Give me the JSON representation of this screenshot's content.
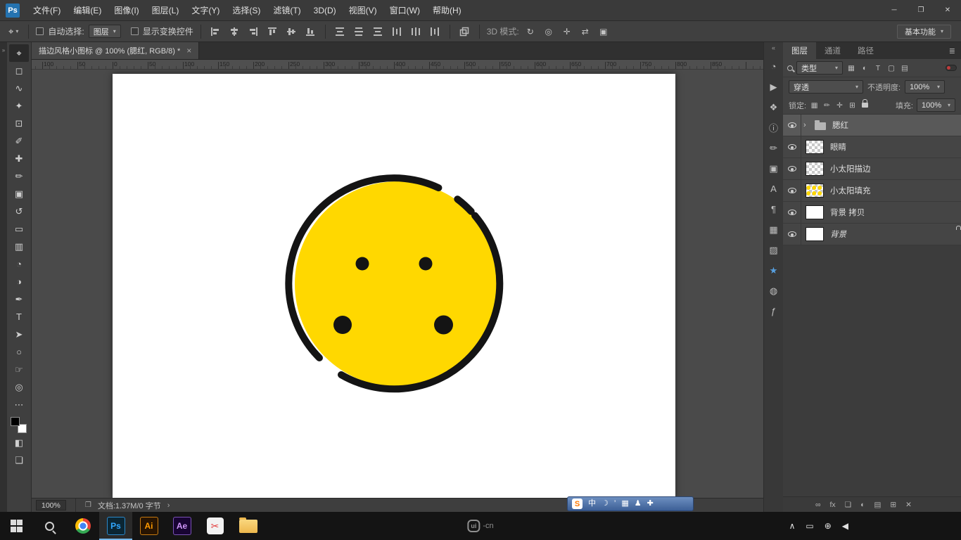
{
  "colors": {
    "canvas_yellow": "#ffd800",
    "ink": "#141414",
    "ps_blue": "#31a8ff",
    "star_blue": "#57a0e0",
    "sogou_orange": "#ff7a00",
    "taskbar_active": "#76b9ed"
  },
  "titlebar": {
    "app_badge": "Ps",
    "menus": [
      {
        "name": "menu-file",
        "label": "文件(F)"
      },
      {
        "name": "menu-edit",
        "label": "编辑(E)"
      },
      {
        "name": "menu-image",
        "label": "图像(I)"
      },
      {
        "name": "menu-layer",
        "label": "图层(L)"
      },
      {
        "name": "menu-type",
        "label": "文字(Y)"
      },
      {
        "name": "menu-select",
        "label": "选择(S)"
      },
      {
        "name": "menu-filter",
        "label": "滤镜(T)"
      },
      {
        "name": "menu-3d",
        "label": "3D(D)"
      },
      {
        "name": "menu-view",
        "label": "视图(V)"
      },
      {
        "name": "menu-window",
        "label": "窗口(W)"
      },
      {
        "name": "menu-help",
        "label": "帮助(H)"
      }
    ],
    "controls": [
      {
        "name": "minimize-button",
        "glyph": "─"
      },
      {
        "name": "restore-button",
        "glyph": "❐"
      },
      {
        "name": "close-button",
        "glyph": "✕"
      }
    ]
  },
  "options_bar": {
    "tool_glyph": "⌖",
    "auto_select_label": "自动选择:",
    "target_value": "图层",
    "show_transform_label": "显示变换控件",
    "mode_label": "3D 模式:",
    "mode_icons": [
      {
        "name": "3d-rotate-icon",
        "glyph": "↻"
      },
      {
        "name": "3d-roll-icon",
        "glyph": "◎"
      },
      {
        "name": "3d-pan-icon",
        "glyph": "✛"
      },
      {
        "name": "3d-slide-icon",
        "glyph": "⇄"
      },
      {
        "name": "3d-scale-icon",
        "glyph": "▣"
      }
    ],
    "workspace_button": "基本功能"
  },
  "document_tab": {
    "title": "描边风格小图标 @ 100% (腮红, RGB/8) *",
    "close_glyph": "×"
  },
  "toolbar": {
    "collapse_glyph": "»",
    "tools": [
      {
        "name": "move-tool",
        "glyph": "⌖",
        "active": true
      },
      {
        "name": "marquee-tool",
        "glyph": "◻"
      },
      {
        "name": "lasso-tool",
        "glyph": "∿"
      },
      {
        "name": "quick-selection-tool",
        "glyph": "✦"
      },
      {
        "name": "crop-tool",
        "glyph": "⊡"
      },
      {
        "name": "eyedropper-tool",
        "glyph": "✐"
      },
      {
        "name": "healing-brush-tool",
        "glyph": "✚"
      },
      {
        "name": "brush-tool",
        "glyph": "✏"
      },
      {
        "name": "clone-stamp-tool",
        "glyph": "▣"
      },
      {
        "name": "history-brush-tool",
        "glyph": "↺"
      },
      {
        "name": "eraser-tool",
        "glyph": "▭"
      },
      {
        "name": "gradient-tool",
        "glyph": "▥"
      },
      {
        "name": "blur-tool",
        "glyph": "◔"
      },
      {
        "name": "dodge-tool",
        "glyph": "◑"
      },
      {
        "name": "pen-tool",
        "glyph": "✒"
      },
      {
        "name": "type-tool",
        "glyph": "T"
      },
      {
        "name": "path-selection-tool",
        "glyph": "➤"
      },
      {
        "name": "shape-tool",
        "glyph": "○"
      },
      {
        "name": "hand-tool",
        "glyph": "☞"
      },
      {
        "name": "zoom-tool",
        "glyph": "◎"
      },
      {
        "name": "edit-toolbar-button",
        "glyph": "⋯"
      }
    ],
    "bottom_tools": [
      {
        "name": "quick-mask-button",
        "glyph": "◧"
      },
      {
        "name": "screen-mode-button",
        "glyph": "❏"
      }
    ]
  },
  "ruler": {
    "labels": [
      "100",
      "50",
      "0",
      "50",
      "100",
      "150",
      "200",
      "250",
      "300",
      "350",
      "400",
      "450",
      "500",
      "550",
      "600",
      "650",
      "700",
      "750",
      "800",
      "850"
    ]
  },
  "status_bar": {
    "zoom": "100%",
    "doc_icon": "❐",
    "doc_info": "文档:1.37M/0 字节",
    "expand_glyph": "›"
  },
  "panel_strip": {
    "collapse_glyph": "«",
    "icons": [
      {
        "name": "history-panel-icon",
        "glyph": "◔"
      },
      {
        "name": "actions-panel-icon",
        "glyph": "▶"
      },
      {
        "name": "adjustments-panel-icon",
        "glyph": "❖"
      },
      {
        "name": "info-panel-icon",
        "glyph": "ⓘ"
      },
      {
        "name": "brush-settings-panel-icon",
        "glyph": "✏"
      },
      {
        "name": "clone-source-panel-icon",
        "glyph": "▣"
      },
      {
        "name": "character-panel-icon",
        "glyph": "A"
      },
      {
        "name": "paragraph-panel-icon",
        "glyph": "¶"
      },
      {
        "name": "swatches-panel-icon",
        "glyph": "▦"
      },
      {
        "name": "styles-panel-icon",
        "glyph": "▨"
      },
      {
        "name": "favorites-panel-icon",
        "glyph": "★",
        "color": "#57a0e0"
      },
      {
        "name": "libraries-panel-icon",
        "glyph": "◍"
      },
      {
        "name": "layer-comps-panel-icon",
        "glyph": "ƒ"
      }
    ]
  },
  "layers_panel": {
    "tabs": [
      {
        "name": "tab-layers",
        "label": "图层",
        "active": true
      },
      {
        "name": "tab-channels",
        "label": "通道"
      },
      {
        "name": "tab-paths",
        "label": "路径"
      }
    ],
    "panel_menu_glyph": "≣",
    "filter": {
      "kind_label": "类型",
      "icons": [
        {
          "name": "filter-pixel-icon",
          "glyph": "▦"
        },
        {
          "name": "filter-adjustment-icon",
          "glyph": "◐"
        },
        {
          "name": "filter-type-icon",
          "glyph": "T"
        },
        {
          "name": "filter-shape-icon",
          "glyph": "▢"
        },
        {
          "name": "filter-smart-icon",
          "glyph": "▤"
        }
      ]
    },
    "blend_mode": "穿透",
    "opacity_label": "不透明度:",
    "opacity_value": "100%",
    "lock_label": "锁定:",
    "lock_icons": [
      {
        "name": "lock-transparent-icon",
        "glyph": "▦"
      },
      {
        "name": "lock-pixels-icon",
        "glyph": "✏"
      },
      {
        "name": "lock-position-icon",
        "glyph": "✛"
      },
      {
        "name": "lock-artboard-icon",
        "glyph": "⊞"
      }
    ],
    "fill_label": "填充:",
    "fill_value": "100%",
    "layers": [
      {
        "name": "腮红",
        "thumb": "folder",
        "selected": true,
        "folder": true
      },
      {
        "name": "眼睛",
        "thumb": "checker"
      },
      {
        "name": "小太阳描边",
        "thumb": "checker"
      },
      {
        "name": "小太阳填充",
        "thumb": "checker-yellow"
      },
      {
        "name": "背景 拷贝",
        "thumb": "white"
      },
      {
        "name": "背景",
        "thumb": "white",
        "locked": true,
        "italic": true
      }
    ],
    "bottom_icons": [
      {
        "name": "link-layers-button",
        "glyph": "∞"
      },
      {
        "name": "layer-style-button",
        "glyph": "fx"
      },
      {
        "name": "layer-mask-button",
        "glyph": "❏"
      },
      {
        "name": "adjustment-layer-button",
        "glyph": "◐"
      },
      {
        "name": "layer-group-button",
        "glyph": "▤"
      },
      {
        "name": "new-layer-button",
        "glyph": "⊞"
      },
      {
        "name": "delete-layer-button",
        "glyph": "✕"
      }
    ]
  },
  "ime_bar": {
    "logo": "S",
    "icons": [
      {
        "name": "ime-chinese-mode",
        "glyph": "中"
      },
      {
        "name": "ime-fullhalf-moon",
        "glyph": "☽"
      },
      {
        "name": "ime-punctuation",
        "glyph": "’"
      },
      {
        "name": "ime-soft-keyboard",
        "glyph": "▦"
      },
      {
        "name": "ime-skin",
        "glyph": "♟"
      },
      {
        "name": "ime-toolbox",
        "glyph": "✚"
      }
    ]
  },
  "taskbar": {
    "apps": [
      {
        "name": "taskbar-photoshop",
        "text": "Ps",
        "fg": "#31a8ff",
        "bg": "#0b2634",
        "border": "#2b87c8",
        "active": true
      },
      {
        "name": "taskbar-illustrator",
        "text": "Ai",
        "fg": "#ff9a00",
        "bg": "#271402",
        "border": "#c77a10"
      },
      {
        "name": "taskbar-aftereffects",
        "text": "Ae",
        "fg": "#cf96fa",
        "bg": "#180433",
        "border": "#7a52b5"
      }
    ],
    "center_logo": {
      "badge": "ui",
      "suffix": "-cn"
    },
    "tray": [
      {
        "name": "tray-show-hidden-icon",
        "glyph": "∧"
      },
      {
        "name": "tray-tablet-icon",
        "glyph": "▭"
      },
      {
        "name": "tray-network-icon",
        "glyph": "⊕"
      },
      {
        "name": "tray-volume-icon",
        "glyph": "◀"
      }
    ]
  }
}
